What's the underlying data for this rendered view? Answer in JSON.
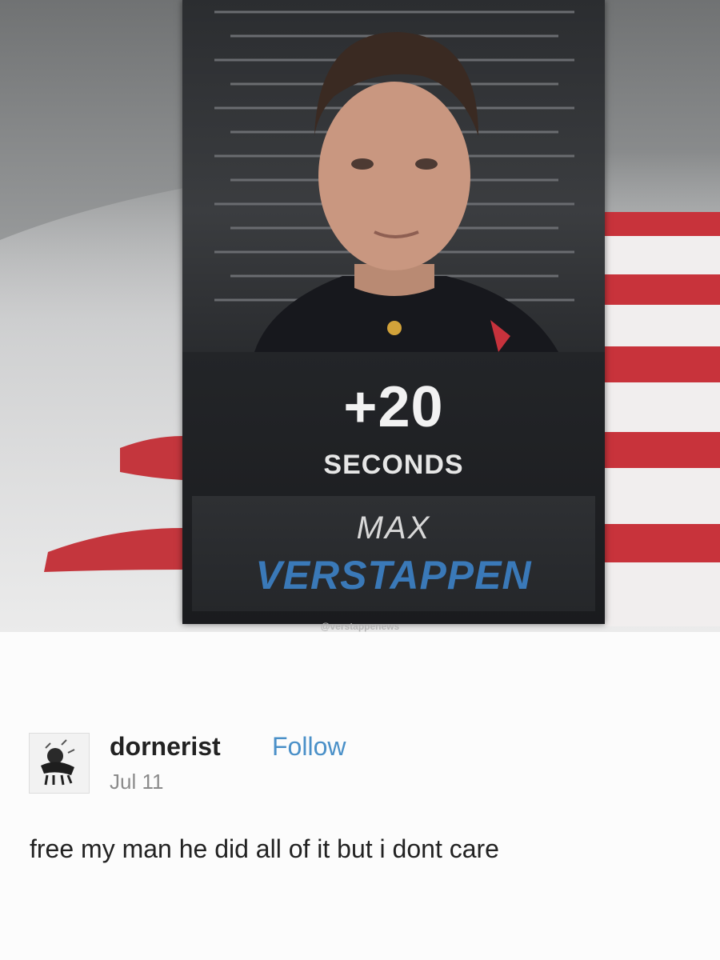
{
  "card": {
    "penalty_value": "+20",
    "penalty_unit": "SECONDS",
    "driver_first_name": "MAX",
    "driver_last_name": "VERSTAPPEN"
  },
  "watermark": "@verstappenews",
  "post": {
    "username": "dornerist",
    "follow_label": "Follow",
    "date": "Jul 11",
    "text": "free my man he did all of it but i dont care"
  },
  "colors": {
    "accent_blue": "#3a79b8",
    "follow_blue": "#4a90c8",
    "flag_red": "#c8333b"
  }
}
